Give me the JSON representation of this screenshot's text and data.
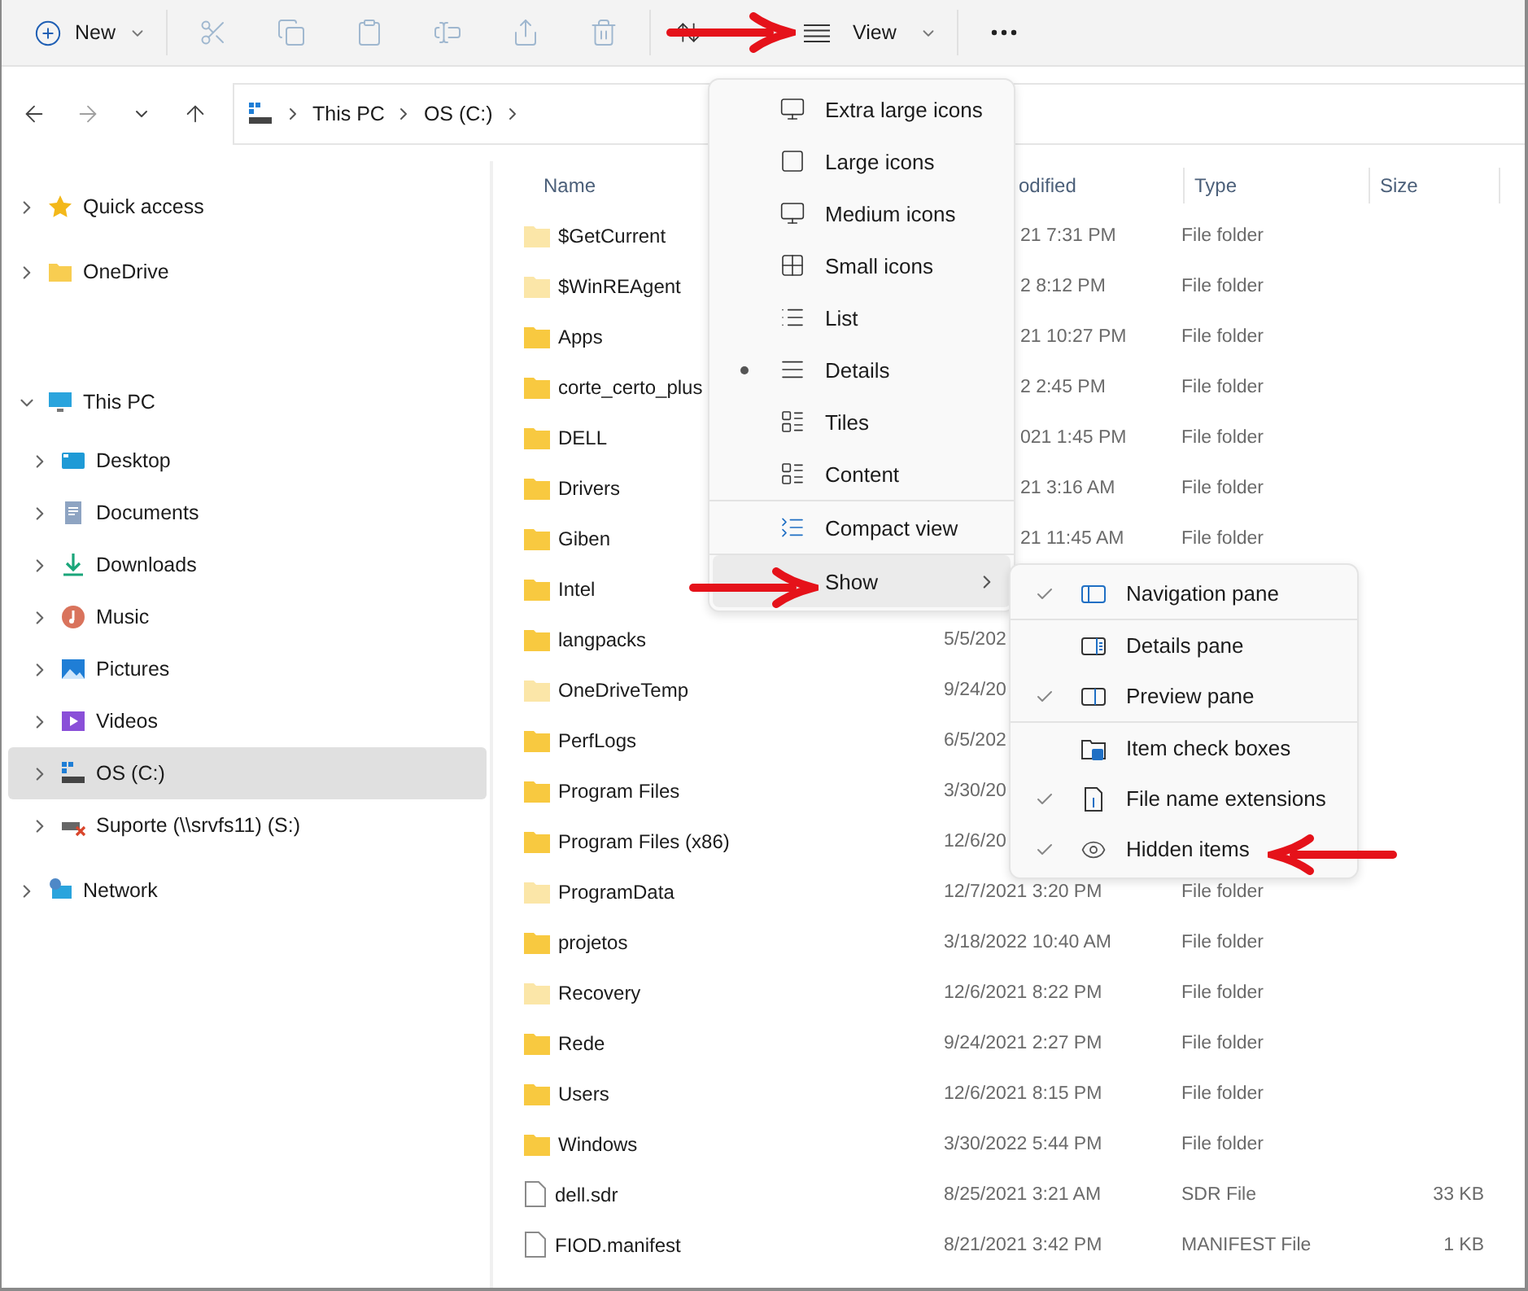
{
  "toolbar": {
    "new_button": {
      "label": "New"
    },
    "actions": [
      {
        "kind": "cut",
        "disabled": true
      },
      {
        "kind": "copy",
        "disabled": true
      },
      {
        "kind": "paste",
        "disabled": true
      },
      {
        "kind": "rename",
        "disabled": true
      },
      {
        "kind": "share",
        "disabled": true
      },
      {
        "kind": "delete",
        "disabled": true
      }
    ],
    "view_button": {
      "label": "View"
    }
  },
  "navigation": {
    "back": {
      "disabled": false
    },
    "forward": {
      "disabled": true
    }
  },
  "address_bar": {
    "crumbs": [
      "This PC",
      "OS (C:)"
    ]
  },
  "sidebar": {
    "groups": [
      [
        {
          "label": "Quick access",
          "kind": "star",
          "expanded": false,
          "selected": false
        },
        {
          "label": "OneDrive",
          "kind": "folder",
          "expanded": false,
          "selected": false
        }
      ],
      [
        {
          "label": "This PC",
          "kind": "pc",
          "expanded": true,
          "selected": false,
          "children": [
            {
              "label": "Desktop",
              "kind": "desktop",
              "expanded": false,
              "selected": false
            },
            {
              "label": "Documents",
              "kind": "documents",
              "expanded": false,
              "selected": false
            },
            {
              "label": "Downloads",
              "kind": "downloads",
              "expanded": false,
              "selected": false
            },
            {
              "label": "Music",
              "kind": "music",
              "expanded": false,
              "selected": false
            },
            {
              "label": "Pictures",
              "kind": "pictures",
              "expanded": false,
              "selected": false
            },
            {
              "label": "Videos",
              "kind": "videos",
              "expanded": false,
              "selected": false
            },
            {
              "label": "OS (C:)",
              "kind": "drive",
              "expanded": false,
              "selected": true
            },
            {
              "label": "Suporte (\\\\srvfs11) (S:)",
              "kind": "network-drive",
              "expanded": false,
              "selected": false
            }
          ]
        }
      ],
      [
        {
          "label": "Network",
          "kind": "network",
          "expanded": false,
          "selected": false
        }
      ]
    ]
  },
  "file_list": {
    "columns": [
      {
        "label": "Name",
        "clipped": false
      },
      {
        "label": "odified",
        "clipped": true
      },
      {
        "label": "Type",
        "clipped": false
      },
      {
        "label": "Size",
        "clipped": false
      }
    ],
    "rows": [
      {
        "name": "$GetCurrent",
        "kind": "folder",
        "hidden": true,
        "date": "21 7:31 PM",
        "date_clipped": true,
        "type": "File folder"
      },
      {
        "name": "$WinREAgent",
        "kind": "folder",
        "hidden": true,
        "date": "2 8:12 PM",
        "date_clipped": true,
        "type": "File folder"
      },
      {
        "name": "Apps",
        "kind": "folder",
        "hidden": false,
        "date": "21 10:27 PM",
        "date_clipped": true,
        "type": "File folder"
      },
      {
        "name": "corte_certo_plus",
        "kind": "folder",
        "hidden": false,
        "date": "2 2:45 PM",
        "date_clipped": true,
        "type": "File folder"
      },
      {
        "name": "DELL",
        "kind": "folder",
        "hidden": false,
        "date": "021 1:45 PM",
        "date_clipped": true,
        "type": "File folder"
      },
      {
        "name": "Drivers",
        "kind": "folder",
        "hidden": false,
        "date": "21 3:16 AM",
        "date_clipped": true,
        "type": "File folder"
      },
      {
        "name": "Giben",
        "kind": "folder",
        "hidden": false,
        "date": "21 11:45 AM",
        "date_clipped": true,
        "type": "File folder"
      },
      {
        "name": "Intel",
        "kind": "folder",
        "hidden": false
      },
      {
        "name": "langpacks",
        "kind": "folder",
        "hidden": false,
        "date": "5/5/202",
        "date_clipped": false
      },
      {
        "name": "OneDriveTemp",
        "kind": "folder",
        "hidden": true,
        "date": "9/24/20",
        "date_clipped": false
      },
      {
        "name": "PerfLogs",
        "kind": "folder",
        "hidden": false,
        "date": "6/5/202",
        "date_clipped": false
      },
      {
        "name": "Program Files",
        "kind": "folder",
        "hidden": false,
        "date": "3/30/20",
        "date_clipped": false
      },
      {
        "name": "Program Files (x86)",
        "kind": "folder",
        "hidden": false,
        "date": "12/6/20",
        "date_clipped": false
      },
      {
        "name": "ProgramData",
        "kind": "folder",
        "hidden": true,
        "date": "12/7/2021 3:20 PM",
        "type": "File folder"
      },
      {
        "name": "projetos",
        "kind": "folder",
        "hidden": false,
        "date": "3/18/2022 10:40 AM",
        "type": "File folder"
      },
      {
        "name": "Recovery",
        "kind": "folder",
        "hidden": true,
        "date": "12/6/2021 8:22 PM",
        "type": "File folder"
      },
      {
        "name": "Rede",
        "kind": "folder",
        "hidden": false,
        "date": "9/24/2021 2:27 PM",
        "type": "File folder"
      },
      {
        "name": "Users",
        "kind": "folder",
        "hidden": false,
        "date": "12/6/2021 8:15 PM",
        "type": "File folder"
      },
      {
        "name": "Windows",
        "kind": "folder",
        "hidden": false,
        "date": "3/30/2022 5:44 PM",
        "type": "File folder"
      },
      {
        "name": "dell.sdr",
        "kind": "file",
        "hidden": false,
        "date": "8/25/2021 3:21 AM",
        "type": "SDR File",
        "size": "33 KB"
      },
      {
        "name": "FIOD.manifest",
        "kind": "file",
        "hidden": false,
        "date": "8/21/2021 3:42 PM",
        "type": "MANIFEST File",
        "size": "1 KB"
      }
    ]
  },
  "view_menu": {
    "sections": [
      [
        {
          "label": "Extra large icons",
          "kind": "option",
          "selected": false
        },
        {
          "label": "Large icons",
          "kind": "option",
          "selected": false
        },
        {
          "label": "Medium icons",
          "kind": "option",
          "selected": false
        },
        {
          "label": "Small icons",
          "kind": "option",
          "selected": false
        },
        {
          "label": "List",
          "kind": "option",
          "selected": false
        },
        {
          "label": "Details",
          "kind": "option",
          "selected": true
        },
        {
          "label": "Tiles",
          "kind": "option",
          "selected": false
        },
        {
          "label": "Content",
          "kind": "option",
          "selected": false
        }
      ],
      [
        {
          "label": "Compact view",
          "kind": "option",
          "selected": false
        }
      ],
      [
        {
          "label": "Show",
          "kind": "submenu",
          "expanded": true
        }
      ]
    ]
  },
  "show_menu": {
    "sections": [
      [
        {
          "label": "Navigation pane",
          "checked": true
        }
      ],
      [
        {
          "label": "Details pane",
          "checked": false
        },
        {
          "label": "Preview pane",
          "checked": true
        }
      ],
      [
        {
          "label": "Item check boxes",
          "checked": false
        },
        {
          "label": "File name extensions",
          "checked": true
        },
        {
          "label": "Hidden items",
          "checked": true
        }
      ]
    ]
  }
}
